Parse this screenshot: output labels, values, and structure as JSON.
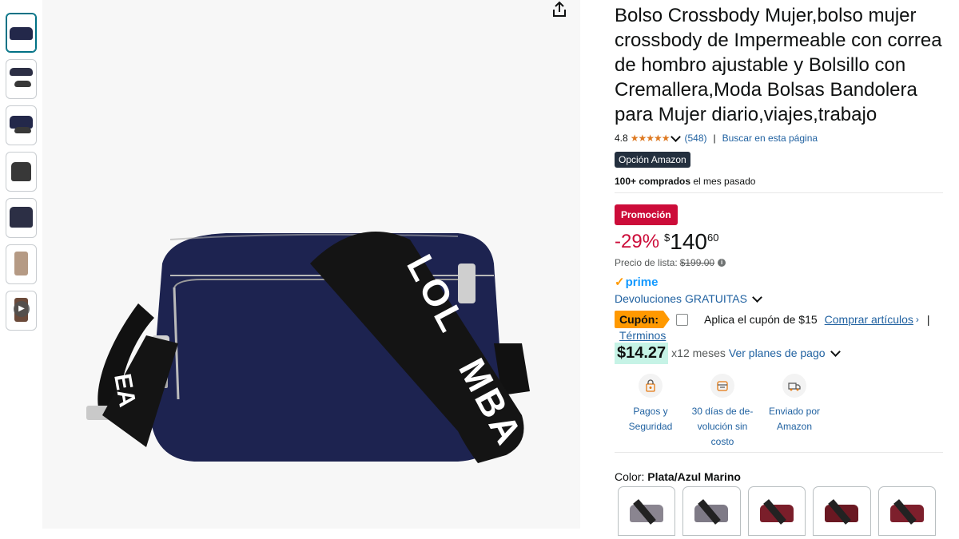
{
  "title": "Bolso Crossbody Mujer,bolso mujer crossbody de Impermeable con correa de hombro ajustable y Bolsillo con Cremallera,Moda Bolsas Bandolera para Mujer diario,viajes,trabajo",
  "rating": {
    "value": "4.8",
    "stars": "★★★★★",
    "count": "(548)",
    "search_page": "Buscar en esta página"
  },
  "badge": "Opción Amazon",
  "bought": {
    "bold": "100+ comprados",
    "rest": " el mes pasado"
  },
  "promo": "Promoción",
  "price": {
    "discount": "-29%",
    "currency": "$",
    "whole": "140",
    "fraction": "60",
    "list_label": "Precio de lista:",
    "list_value": "$199.00"
  },
  "prime": "prime",
  "returns": "Devoluciones GRATUITAS",
  "coupon": {
    "tag": "Cupón:",
    "text": "Aplica el cupón de $15",
    "link": "Comprar artículos",
    "arrow": "›",
    "pipe": "|",
    "terms": "Términos"
  },
  "installments": {
    "amount": "$14.27",
    "months": "x12 meses",
    "link": "Ver planes de pago"
  },
  "features": [
    {
      "label": "Pagos y Seguridad",
      "icon": "secure-payment-icon"
    },
    {
      "label": "30 días de de-volución sin costo",
      "icon": "return-box-icon"
    },
    {
      "label": "Enviado por Amazon",
      "icon": "delivery-truck-icon"
    }
  ],
  "color": {
    "label": "Color:",
    "value": "Plata/Azul Marino"
  },
  "swatch_colors": [
    "#8a8590",
    "#7e7a86",
    "#7a1e2a",
    "#6a1822",
    "#7d1f2c"
  ],
  "brand_colors": {
    "link": "#2162a1",
    "deal": "#cc0c39",
    "prime": "#1399ff",
    "coupon": "#ff9900"
  },
  "thumbnails": [
    "bag-front",
    "bag-details",
    "bag-pockets",
    "bag-strap",
    "bag-gift",
    "bag-model",
    "video"
  ]
}
